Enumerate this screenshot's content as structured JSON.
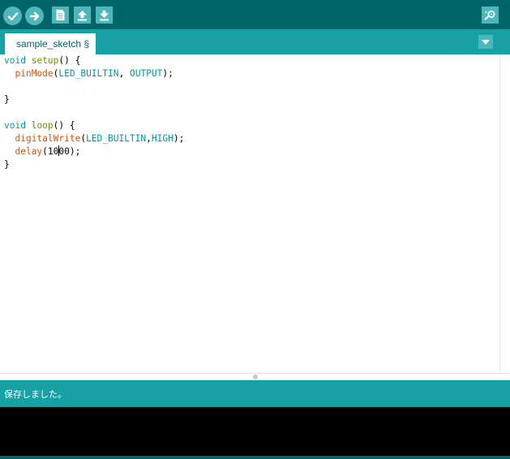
{
  "colors": {
    "toolbar_bg": "#006468",
    "tab_bar_bg": "#17a1a5",
    "button_bg": "#4db7bb",
    "keyword": "#00979c",
    "function": "#d35400",
    "constant": "#00979c",
    "console_bg": "#000000"
  },
  "toolbar": {
    "buttons": [
      "verify-icon",
      "upload-icon",
      "new-icon",
      "open-icon",
      "save-icon"
    ],
    "right_button": "serial-monitor-icon"
  },
  "tabs": [
    {
      "label": "sample_sketch §",
      "active": true
    }
  ],
  "tab_menu_icon": "dropdown-arrow-icon",
  "code": {
    "l1": {
      "kw": "void",
      "fn": "setup",
      "rest": "() {"
    },
    "l2": {
      "indent": "  ",
      "fn": "pinMode",
      "open": "(",
      "arg1": "LED_BUILTIN",
      "sep": ", ",
      "arg2": "OUTPUT",
      "close": ");"
    },
    "l4": {
      "text": "}"
    },
    "l6": {
      "kw": "void",
      "fn": "loop",
      "rest": "() {"
    },
    "l7": {
      "indent": "  ",
      "fn": "digitalWrite",
      "open": "(",
      "arg1": "LED_BUILTIN",
      "sep": ",",
      "arg2": "HIGH",
      "close": ");"
    },
    "l8": {
      "indent": "  ",
      "fn": "delay",
      "before_caret": "(10",
      "after_caret": "00);"
    },
    "l9": {
      "text": "}"
    }
  },
  "status": {
    "message": "保存しました。"
  }
}
